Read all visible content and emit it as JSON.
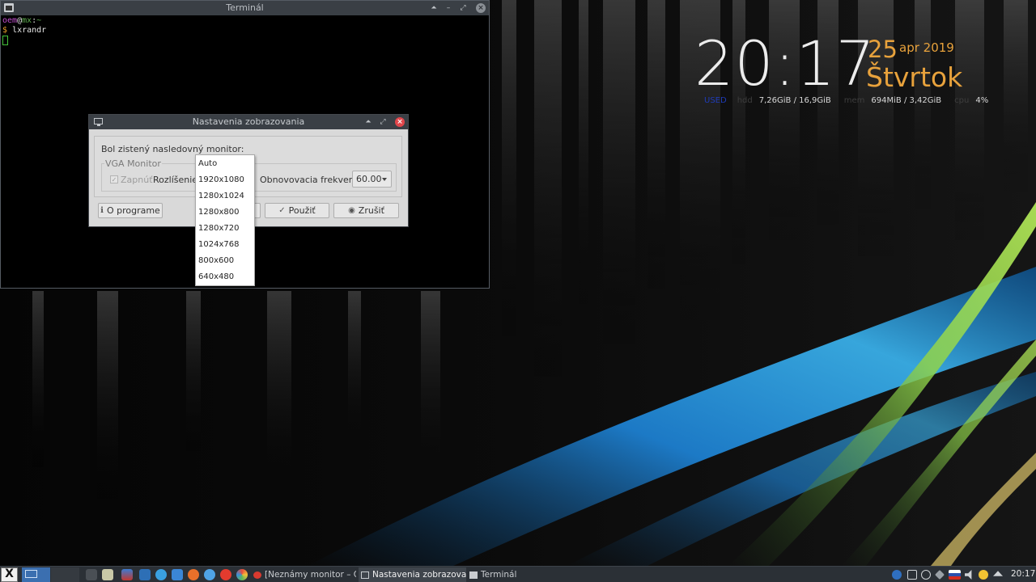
{
  "terminal": {
    "title": "Terminál",
    "lines": [
      {
        "user": "oem",
        "at": "@",
        "host": "mx",
        "sep": ":",
        "path": "~"
      },
      {
        "prompt": "$",
        "command": "lxrandr"
      }
    ]
  },
  "dialog": {
    "title": "Nastavenia zobrazovania",
    "detected_label": "Bol zistený nasledovný monitor:",
    "monitor_name": "VGA Monitor",
    "enable_label": "Zapnúť",
    "resolution_label": "Rozlíšenie:",
    "refresh_label": "Obnovovacia frekvencia:",
    "refresh_value": "60.00",
    "buttons": {
      "about": "O programe",
      "apply": "Použiť",
      "cancel": "Zrušiť"
    }
  },
  "resolution_dropdown": {
    "options": [
      "Auto",
      "1920x1080",
      "1280x1024",
      "1280x800",
      "1280x720",
      "1024x768",
      "800x600",
      "640x480"
    ]
  },
  "conky": {
    "time": "20:17",
    "day": "25",
    "month_year": "apr 2019",
    "weekday": "Štvrtok",
    "used_label": "USED",
    "hdd_label": "hdd",
    "hdd_value": "7,26GiB / 16,9GiB",
    "mem_label": "mem",
    "mem_value": "694MiB / 3,42GiB",
    "cpu_label": "cpu",
    "cpu_value": "4%"
  },
  "taskbar": {
    "tasks": [
      {
        "label": "[Neznámy monitor – O..."
      },
      {
        "label": "Nastavenia zobrazovania"
      },
      {
        "label": "Terminál"
      }
    ],
    "clock": "20:17"
  },
  "colors": {
    "conky_accent": "#e8a23c",
    "titlebar": "#3a3f45",
    "taskbar": "#2b3036",
    "dialog_bg": "#d9d9d9",
    "close_red": "#e1464b"
  }
}
